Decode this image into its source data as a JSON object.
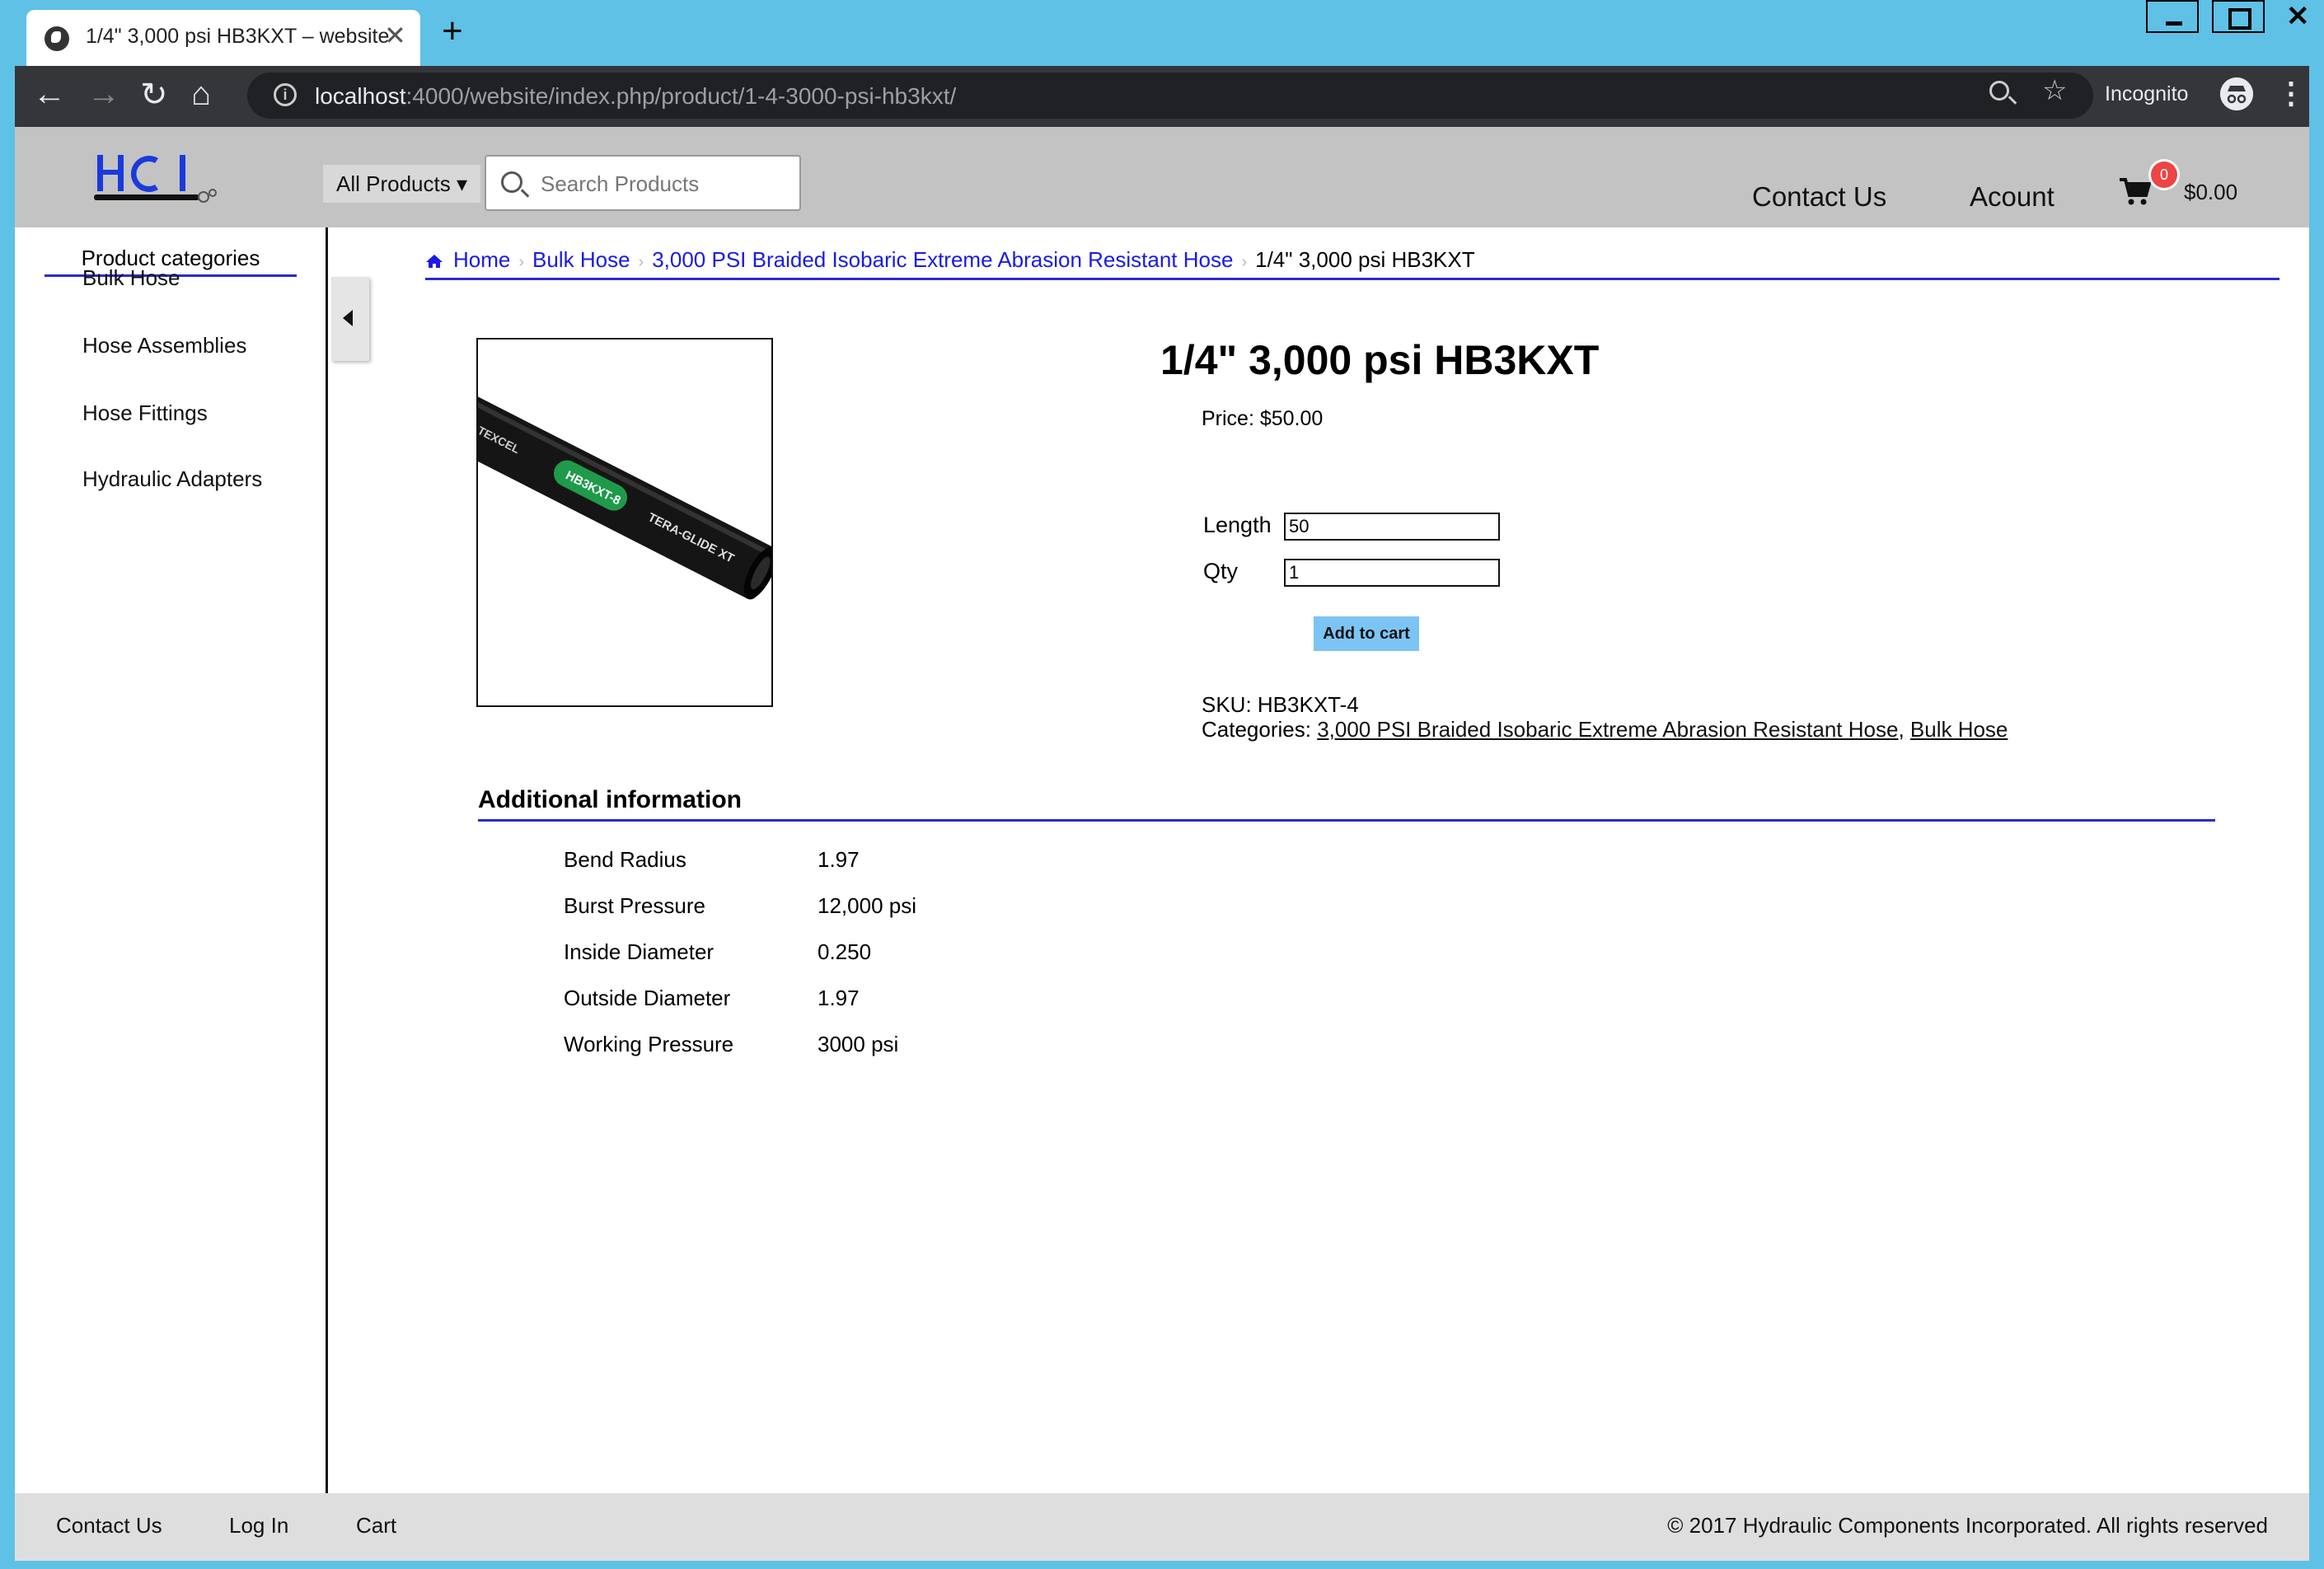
{
  "browser": {
    "tab_title": "1/4\" 3,000 psi HB3KXT – website",
    "tab_close": "✕",
    "new_tab": "+",
    "url_host": "localhost",
    "url_rest": ":4000/website/index.php/product/1-4-3000-psi-hb3kxt/",
    "incognito_label": "Incognito",
    "back": "←",
    "forward": "→",
    "reload": "↻",
    "home": "⌂"
  },
  "header": {
    "all_products": "All Products ▾",
    "search_placeholder": "Search Products",
    "contact": "Contact Us",
    "account": "Acount",
    "cart_count": "0",
    "cart_total": "$0.00"
  },
  "sidebar": {
    "heading": "Product categories",
    "items": [
      {
        "label": "Bulk Hose"
      },
      {
        "label": "Hose Assemblies"
      },
      {
        "label": "Hose Fittings"
      },
      {
        "label": "Hydraulic Adapters"
      }
    ]
  },
  "breadcrumb": {
    "home": "Home",
    "crumb1": "Bulk Hose",
    "crumb2": "3,000 PSI Braided Isobaric Extreme Abrasion Resistant Hose",
    "current": "1/4\" 3,000 psi HB3KXT",
    "separator": "›"
  },
  "product": {
    "title": "1/4\" 3,000 psi HB3KXT",
    "price": "Price: $50.00",
    "length_label": "Length",
    "length_value": "50",
    "qty_label": "Qty",
    "qty_value": "1",
    "add_to_cart": "Add to cart",
    "sku": "SKU: HB3KXT-4",
    "categories_label": "Categories: ",
    "category1": "3,000 PSI Braided Isobaric Extreme Abrasion Resistant Hose",
    "category_sep": ", ",
    "category2": "Bulk Hose",
    "image_text": {
      "brand": "TEXCEL",
      "model": "HB3KXT-8",
      "line": "TERA-GLIDE XT"
    }
  },
  "additional": {
    "heading": "Additional information",
    "specs": [
      {
        "label": "Bend Radius",
        "value": "1.97"
      },
      {
        "label": "Burst Pressure",
        "value": "12,000 psi"
      },
      {
        "label": "Inside Diameter",
        "value": "0.250"
      },
      {
        "label": "Outside Diameter",
        "value": "1.97"
      },
      {
        "label": "Working Pressure",
        "value": "3000 psi"
      }
    ]
  },
  "footer": {
    "contact": "Contact Us",
    "login": "Log In",
    "cart": "Cart",
    "copyright": "© 2017 Hydraulic Components Incorporated. All rights reserved"
  }
}
